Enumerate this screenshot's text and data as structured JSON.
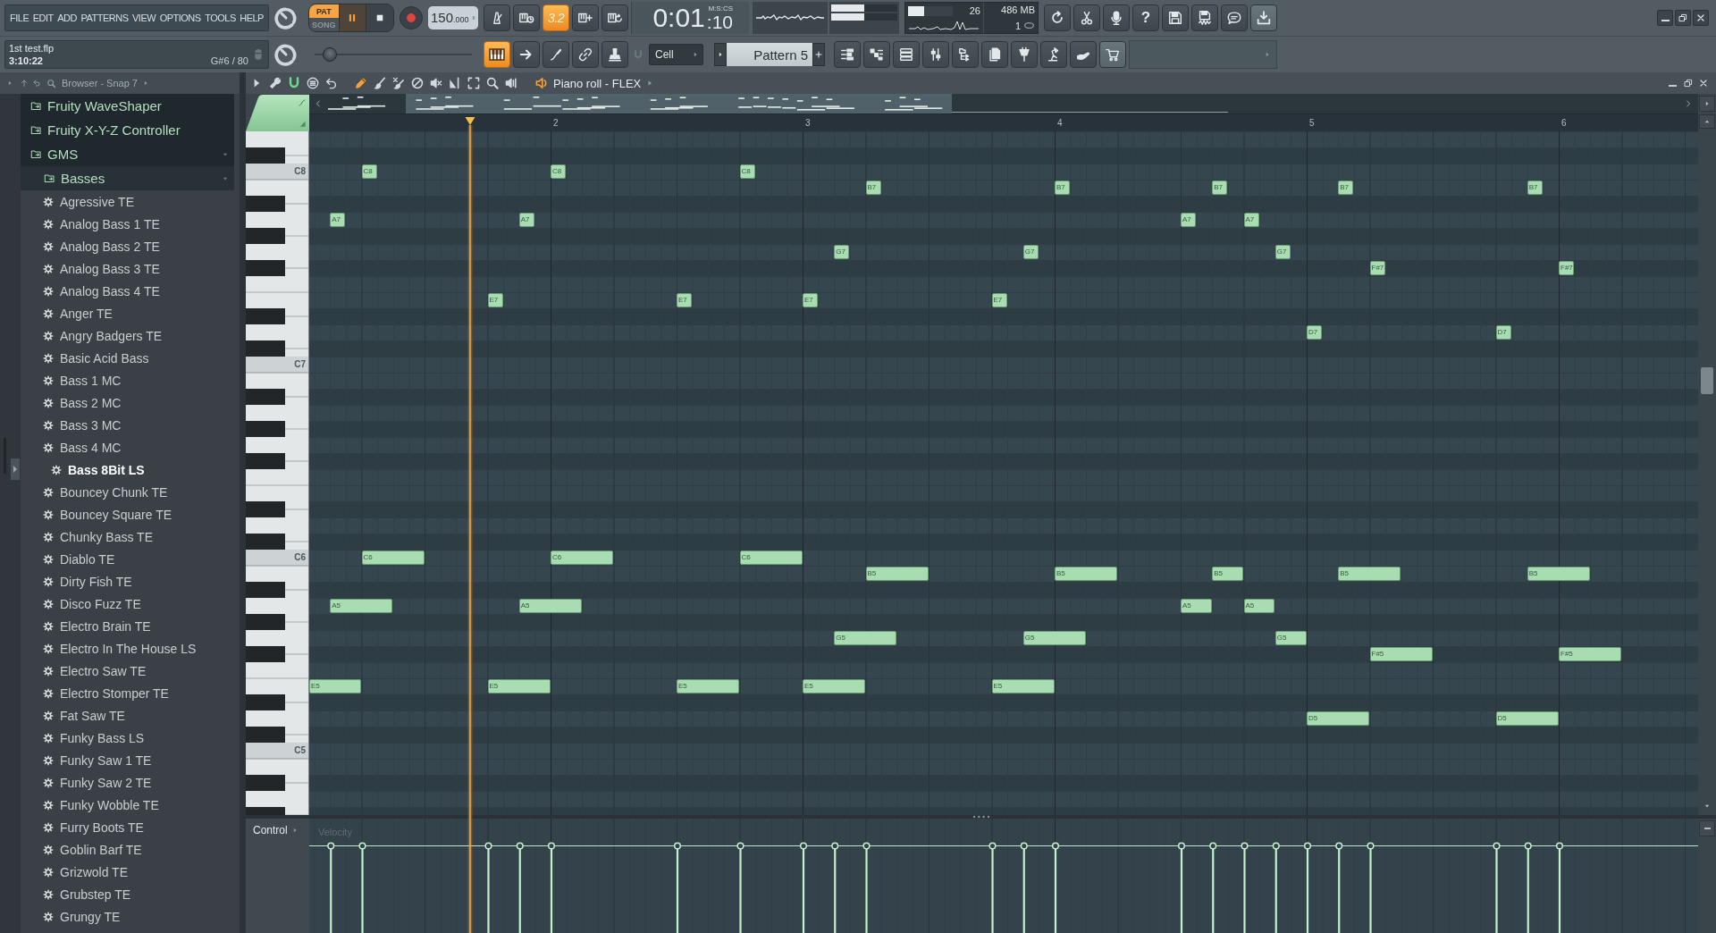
{
  "menu": [
    "FILE",
    "EDIT",
    "ADD",
    "PATTERNS",
    "VIEW",
    "OPTIONS",
    "TOOLS",
    "HELP"
  ],
  "project": {
    "file": "1st test.flp",
    "time": "3:10:22",
    "hint": "G#6 / 80"
  },
  "transport": {
    "modes": [
      {
        "label": "PAT",
        "selected": true
      },
      {
        "label": "SONG",
        "selected": false
      }
    ],
    "playing": true,
    "tempo": "150",
    "tempo_decimals": ".000"
  },
  "record_options": [
    {
      "kind": "metronome",
      "on": false
    },
    {
      "kind": "wait",
      "on": false
    },
    {
      "kind": "countdown",
      "on": true,
      "label": "3.2"
    },
    {
      "kind": "step",
      "on": false
    },
    {
      "kind": "loop",
      "on": false
    }
  ],
  "time_display": {
    "value": "0:01",
    "centiseconds": ":10",
    "unit": "M:S:CS"
  },
  "peak_meter": [
    {
      "level": 0.5
    },
    {
      "level": 0.5
    }
  ],
  "monitor": {
    "cpu": "26",
    "memory": "486 MB",
    "polyphony": "1",
    "level": 0.35
  },
  "help": {
    "label": "?"
  },
  "typing_keyboard": {
    "on": true
  },
  "pitch_slider": {
    "level": 0.08
  },
  "snap": {
    "value": "Cell"
  },
  "pattern": {
    "value": "Pattern 5"
  },
  "browser": {
    "title": "Browser - Snap 7",
    "items": [
      {
        "kind": "folder",
        "label": "Fruity WaveShaper",
        "expanded": false
      },
      {
        "kind": "folder",
        "label": "Fruity X-Y-Z Controller",
        "expanded": false
      },
      {
        "kind": "folder",
        "label": "GMS",
        "expanded": true,
        "children": [
          {
            "kind": "folder",
            "label": "Basses",
            "expanded": true,
            "children": [
              {
                "kind": "preset",
                "label": "Agressive TE",
                "selected": false
              },
              {
                "kind": "preset",
                "label": "Analog Bass 1 TE",
                "selected": false
              },
              {
                "kind": "preset",
                "label": "Analog Bass 2 TE",
                "selected": false
              },
              {
                "kind": "preset",
                "label": "Analog Bass 3 TE",
                "selected": false
              },
              {
                "kind": "preset",
                "label": "Analog Bass 4 TE",
                "selected": false
              },
              {
                "kind": "preset",
                "label": "Anger TE",
                "selected": false
              },
              {
                "kind": "preset",
                "label": "Angry Badgers TE",
                "selected": false
              },
              {
                "kind": "preset",
                "label": "Basic Acid Bass",
                "selected": false
              },
              {
                "kind": "preset",
                "label": "Bass 1 MC",
                "selected": false
              },
              {
                "kind": "preset",
                "label": "Bass 2 MC",
                "selected": false
              },
              {
                "kind": "preset",
                "label": "Bass 3 MC",
                "selected": false
              },
              {
                "kind": "preset",
                "label": "Bass 4 MC",
                "selected": false
              },
              {
                "kind": "preset",
                "label": "Bass 8Bit LS",
                "selected": true
              },
              {
                "kind": "preset",
                "label": "Bouncey Chunk TE",
                "selected": false
              },
              {
                "kind": "preset",
                "label": "Bouncey Square TE",
                "selected": false
              },
              {
                "kind": "preset",
                "label": "Chunky Bass TE",
                "selected": false
              },
              {
                "kind": "preset",
                "label": "Diablo TE",
                "selected": false
              },
              {
                "kind": "preset",
                "label": "Dirty Fish TE",
                "selected": false
              },
              {
                "kind": "preset",
                "label": "Disco Fuzz TE",
                "selected": false
              },
              {
                "kind": "preset",
                "label": "Electro Brain TE",
                "selected": false
              },
              {
                "kind": "preset",
                "label": "Electro In The House LS",
                "selected": false
              },
              {
                "kind": "preset",
                "label": "Electro Saw TE",
                "selected": false
              },
              {
                "kind": "preset",
                "label": "Electro Stomper TE",
                "selected": false
              },
              {
                "kind": "preset",
                "label": "Fat Saw TE",
                "selected": false
              },
              {
                "kind": "preset",
                "label": "Funky Bass LS",
                "selected": false
              },
              {
                "kind": "preset",
                "label": "Funky Saw 1 TE",
                "selected": false
              },
              {
                "kind": "preset",
                "label": "Funky Saw 2 TE",
                "selected": false
              },
              {
                "kind": "preset",
                "label": "Funky Wobble TE",
                "selected": false
              },
              {
                "kind": "preset",
                "label": "Furry Boots TE",
                "selected": false
              },
              {
                "kind": "preset",
                "label": "Goblin Barf TE",
                "selected": false
              },
              {
                "kind": "preset",
                "label": "Grizwold TE",
                "selected": false
              },
              {
                "kind": "preset",
                "label": "Grubstep TE",
                "selected": false
              },
              {
                "kind": "preset",
                "label": "Grungy TE",
                "selected": false
              }
            ]
          }
        ]
      }
    ]
  },
  "piano_roll": {
    "title": "Piano roll - FLEX",
    "snap_to_grid": {
      "on": true
    },
    "tools": [
      {
        "kind": "draw",
        "selected": true
      },
      {
        "kind": "paint",
        "selected": false
      },
      {
        "kind": "paint_delete",
        "selected": false
      },
      {
        "kind": "delete",
        "selected": false
      },
      {
        "kind": "mute",
        "selected": false
      },
      {
        "kind": "slice",
        "selected": false
      },
      {
        "kind": "select",
        "selected": false
      },
      {
        "kind": "zoom",
        "selected": false
      },
      {
        "kind": "playback",
        "selected": false
      }
    ],
    "bars": [
      "2",
      "3",
      "4",
      "5",
      "6"
    ],
    "keys": [
      "C8",
      "C7",
      "C6",
      "C5"
    ],
    "notes": [
      {
        "label": "C8"
      },
      {
        "label": "C8"
      },
      {
        "label": "C8"
      },
      {
        "label": "B7"
      },
      {
        "label": "B7"
      },
      {
        "label": "B7"
      },
      {
        "label": "B7"
      },
      {
        "label": "B7"
      },
      {
        "label": "A7"
      },
      {
        "label": "A7"
      },
      {
        "label": "A7"
      },
      {
        "label": "A7"
      },
      {
        "label": "G7"
      },
      {
        "label": "G7"
      },
      {
        "label": "G7"
      },
      {
        "label": "F#7"
      },
      {
        "label": "F#7"
      },
      {
        "label": "E7"
      },
      {
        "label": "E7"
      },
      {
        "label": "E7"
      },
      {
        "label": "E7"
      },
      {
        "label": "D7"
      },
      {
        "label": "D7"
      },
      {
        "label": "C6"
      },
      {
        "label": "C6"
      },
      {
        "label": "C6"
      },
      {
        "label": "B5"
      },
      {
        "label": "B5"
      },
      {
        "label": "B5"
      },
      {
        "label": "B5"
      },
      {
        "label": "B5"
      },
      {
        "label": "A5"
      },
      {
        "label": "A5"
      },
      {
        "label": "A5"
      },
      {
        "label": "A5"
      },
      {
        "label": "G5"
      },
      {
        "label": "G5"
      },
      {
        "label": "G5"
      },
      {
        "label": "F#5"
      },
      {
        "label": "F#5"
      },
      {
        "label": "E5"
      },
      {
        "label": "E5"
      },
      {
        "label": "E5"
      },
      {
        "label": "E5"
      },
      {
        "label": "E5"
      },
      {
        "label": "D5"
      },
      {
        "label": "D5"
      }
    ],
    "control": {
      "label": "Control",
      "lane": "Velocity"
    }
  }
}
